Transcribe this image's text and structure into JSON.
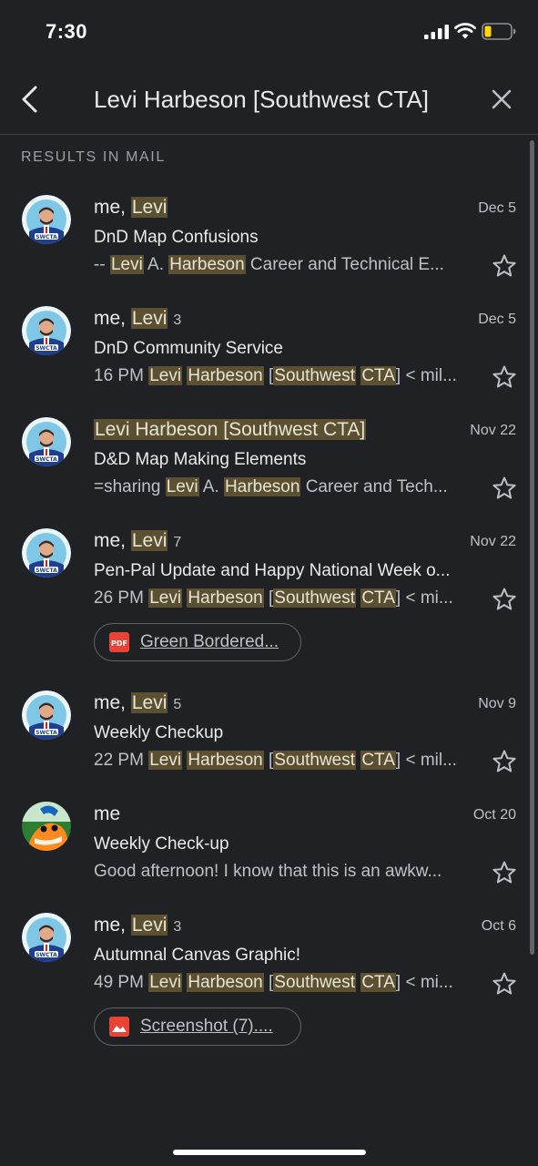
{
  "status": {
    "time": "7:30"
  },
  "search": {
    "query": "Levi Harbeson [Southwest CTA]"
  },
  "section_label": "RESULTS IN MAIL",
  "mails": [
    {
      "sender_prefix": "me, ",
      "sender_hl": "Levi",
      "sender_suffix": "",
      "count": "",
      "date": "Dec 5",
      "subject": "DnD Map Confusions",
      "snippet": [
        {
          "t": "-- ",
          "h": false
        },
        {
          "t": "Levi",
          "h": true
        },
        {
          "t": " A. ",
          "h": false
        },
        {
          "t": "Harbeson",
          "h": true
        },
        {
          "t": " Career and Technical E...",
          "h": false
        }
      ],
      "avatar": "swcta"
    },
    {
      "sender_prefix": "me, ",
      "sender_hl": "Levi",
      "sender_suffix": "",
      "count": "3",
      "date": "Dec 5",
      "subject": "DnD Community Service",
      "snippet": [
        {
          "t": "16 PM ",
          "h": false
        },
        {
          "t": "Levi",
          "h": true
        },
        {
          "t": " ",
          "h": false
        },
        {
          "t": "Harbeson",
          "h": true
        },
        {
          "t": " [",
          "h": false
        },
        {
          "t": "Southwest",
          "h": true
        },
        {
          "t": " ",
          "h": false
        },
        {
          "t": "CTA",
          "h": true
        },
        {
          "t": "] < mil...",
          "h": false
        }
      ],
      "avatar": "swcta"
    },
    {
      "sender_prefix": "",
      "sender_hl": "Levi Harbeson [Southwest CTA]",
      "sender_suffix": "",
      "count": "",
      "date": "Nov 22",
      "subject": "D&D Map Making Elements",
      "snippet": [
        {
          "t": "=sharing ",
          "h": false
        },
        {
          "t": "Levi",
          "h": true
        },
        {
          "t": " A. ",
          "h": false
        },
        {
          "t": "Harbeson",
          "h": true
        },
        {
          "t": " Career and Tech...",
          "h": false
        }
      ],
      "avatar": "swcta"
    },
    {
      "sender_prefix": "me, ",
      "sender_hl": "Levi",
      "sender_suffix": "",
      "count": "7",
      "date": "Nov 22",
      "subject": "Pen-Pal Update and Happy National Week o...",
      "snippet": [
        {
          "t": "26 PM ",
          "h": false
        },
        {
          "t": "Levi",
          "h": true
        },
        {
          "t": " ",
          "h": false
        },
        {
          "t": "Harbeson",
          "h": true
        },
        {
          "t": " [",
          "h": false
        },
        {
          "t": "Southwest",
          "h": true
        },
        {
          "t": " ",
          "h": false
        },
        {
          "t": "CTA",
          "h": true
        },
        {
          "t": "] < mi...",
          "h": false
        }
      ],
      "avatar": "swcta",
      "attachment": {
        "type": "pdf",
        "icon_text": "PDF",
        "label": "Green Bordered..."
      }
    },
    {
      "sender_prefix": "me, ",
      "sender_hl": "Levi",
      "sender_suffix": "",
      "count": "5",
      "date": "Nov 9",
      "subject": "Weekly Checkup",
      "snippet": [
        {
          "t": "22 PM ",
          "h": false
        },
        {
          "t": "Levi",
          "h": true
        },
        {
          "t": " ",
          "h": false
        },
        {
          "t": "Harbeson",
          "h": true
        },
        {
          "t": " [",
          "h": false
        },
        {
          "t": "Southwest",
          "h": true
        },
        {
          "t": " ",
          "h": false
        },
        {
          "t": "CTA",
          "h": true
        },
        {
          "t": "] < mil...",
          "h": false
        }
      ],
      "avatar": "swcta"
    },
    {
      "sender_prefix": "me",
      "sender_hl": "",
      "sender_suffix": "",
      "count": "",
      "date": "Oct 20",
      "subject": "Weekly Check-up",
      "snippet": [
        {
          "t": "Good afternoon! I know that this is an awkw...",
          "h": false
        }
      ],
      "avatar": "fish"
    },
    {
      "sender_prefix": "me, ",
      "sender_hl": "Levi",
      "sender_suffix": "",
      "count": "3",
      "date": "Oct 6",
      "subject": "Autumnal Canvas Graphic!",
      "snippet": [
        {
          "t": "49 PM ",
          "h": false
        },
        {
          "t": "Levi",
          "h": true
        },
        {
          "t": " ",
          "h": false
        },
        {
          "t": "Harbeson",
          "h": true
        },
        {
          "t": " [",
          "h": false
        },
        {
          "t": "Southwest",
          "h": true
        },
        {
          "t": " ",
          "h": false
        },
        {
          "t": "CTA",
          "h": true
        },
        {
          "t": "] < mi...",
          "h": false
        }
      ],
      "avatar": "swcta",
      "attachment": {
        "type": "image",
        "label": "Screenshot (7)...."
      }
    }
  ],
  "colors": {
    "background": "#202124",
    "highlight": "#5b5132",
    "pdf_red": "#ea4335"
  }
}
